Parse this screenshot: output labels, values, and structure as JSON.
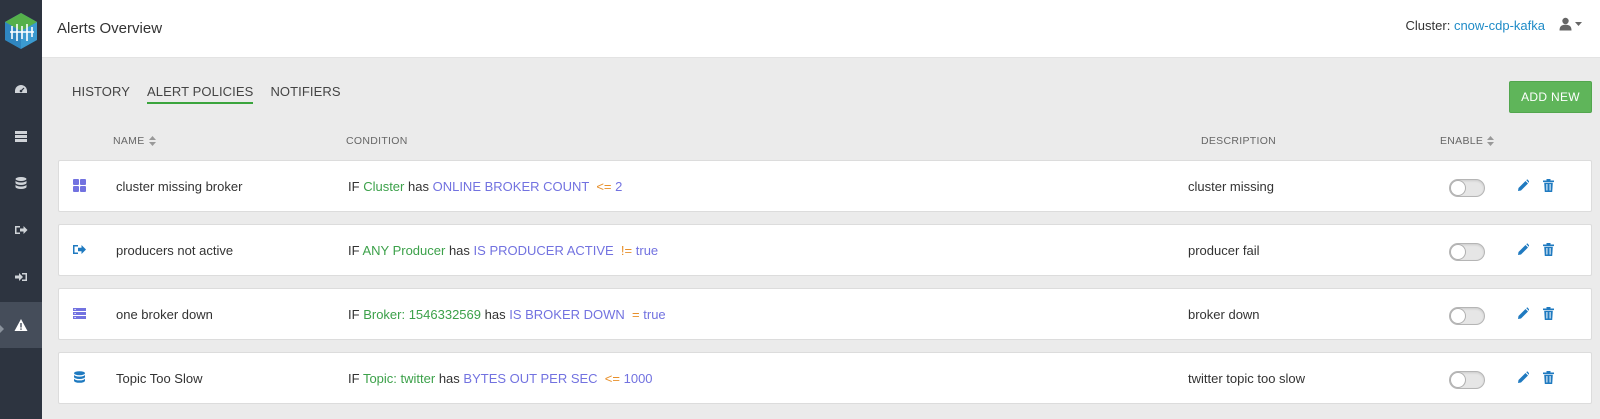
{
  "header": {
    "title": "Alerts Overview",
    "cluster_label": "Cluster:",
    "cluster_name": "cnow-cdp-kafka"
  },
  "sidebar": {
    "items": [
      {
        "icon": "dashboard-icon"
      },
      {
        "icon": "brokers-icon"
      },
      {
        "icon": "topics-icon"
      },
      {
        "icon": "producers-icon"
      },
      {
        "icon": "consumers-icon"
      },
      {
        "icon": "alerts-icon",
        "active": true
      }
    ]
  },
  "tabs": [
    {
      "label": "HISTORY"
    },
    {
      "label": "ALERT POLICIES",
      "active": true
    },
    {
      "label": "NOTIFIERS"
    }
  ],
  "add_button": "ADD NEW",
  "columns": {
    "name": "NAME",
    "condition": "CONDITION",
    "description": "DESCRIPTION",
    "enable": "ENABLE"
  },
  "rows": [
    {
      "icon": "cluster-icon",
      "name": "cluster missing broker",
      "cond_if": "IF",
      "cond_target": "Cluster",
      "cond_has": "has",
      "cond_metric": "ONLINE BROKER COUNT",
      "cond_op": "<=",
      "cond_value": "2",
      "description": "cluster missing",
      "enabled": false
    },
    {
      "icon": "producer-icon",
      "name": "producers not active",
      "cond_if": "IF",
      "cond_target": "ANY Producer",
      "cond_has": "has",
      "cond_metric": "IS PRODUCER ACTIVE",
      "cond_op": "!=",
      "cond_value": "true",
      "description": "producer fail",
      "enabled": false
    },
    {
      "icon": "broker-icon",
      "name": "one broker down",
      "cond_if": "IF",
      "cond_target": "Broker: 1546332569",
      "cond_has": "has",
      "cond_metric": "IS BROKER DOWN",
      "cond_op": "=",
      "cond_value": "true",
      "description": "broker down",
      "enabled": false
    },
    {
      "icon": "topic-icon",
      "name": "Topic Too Slow",
      "cond_if": "IF",
      "cond_target": "Topic: twitter",
      "cond_has": "has",
      "cond_metric": "BYTES OUT PER SEC",
      "cond_op": "<=",
      "cond_value": "1000",
      "description": "twitter topic too slow",
      "enabled": false
    }
  ],
  "colors": {
    "sidebar_bg": "#2d3440",
    "accent_green": "#5fb55a",
    "link_blue": "#1f8bc7",
    "condition_target": "#3ca14a",
    "condition_metric": "#7272e0",
    "condition_operator": "#e8902b",
    "icon_blue": "#1f7ac0"
  }
}
